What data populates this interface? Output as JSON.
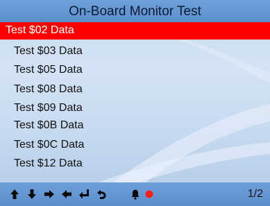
{
  "header": {
    "title": "On-Board Monitor Test"
  },
  "menu": {
    "selected_index": 0,
    "items": [
      {
        "label": "Test $02 Data"
      },
      {
        "label": "Test $03 Data"
      },
      {
        "label": "Test $05 Data"
      },
      {
        "label": "Test $08 Data"
      },
      {
        "label": "Test $09 Data"
      },
      {
        "label": "Test $0B Data"
      },
      {
        "label": "Test $0C Data"
      },
      {
        "label": "Test $12 Data"
      }
    ]
  },
  "footer": {
    "icons": [
      "up-arrow-icon",
      "down-arrow-icon",
      "right-arrow-icon",
      "left-arrow-icon",
      "enter-icon",
      "back-icon",
      "bell-icon",
      "record-icon"
    ],
    "page_indicator": "1/2"
  },
  "colors": {
    "title_bar": "#6a9bd7",
    "selection": "#ff0000",
    "record_dot": "#ff2020",
    "background": "#c9dbf1"
  }
}
